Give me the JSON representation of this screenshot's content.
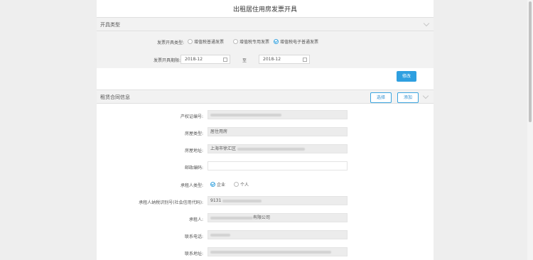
{
  "page_title": "出租居住用房发票开具",
  "invoice_section": {
    "title": "开具类型",
    "type_label": "发票开具类型:",
    "type_options": [
      {
        "label": "增值税普通发票",
        "selected": false
      },
      {
        "label": "增值税专用发票",
        "selected": false
      },
      {
        "label": "增值税电子普通发票",
        "selected": true
      }
    ],
    "period_label": "发票开具期限:",
    "period_start": "2018-12",
    "period_sep": "至",
    "period_end": "2018-12",
    "modify_button": "修改"
  },
  "contract_section": {
    "title": "租赁合同信息",
    "select_button": "选择",
    "add_button": "添加",
    "fields": {
      "property_cert_label": "产权证编号:",
      "property_cert_value": "",
      "house_type_label": "房屋类型:",
      "house_type_value": "居住用房",
      "address_label": "房屋地址:",
      "address_value": "上海市徐汇区",
      "postal_label": "邮政编码:",
      "postal_value": "",
      "lessee_type_label": "承租人类型:",
      "lessee_type_options": [
        {
          "label": "企业",
          "selected": true
        },
        {
          "label": "个人",
          "selected": false
        }
      ],
      "tax_id_label": "承租人纳税识别号(社会信用代码):",
      "tax_id_value": "9131",
      "lessee_label": "承租人:",
      "lessee_value": "有限公司",
      "phone_label": "联系电话:",
      "phone_value": "",
      "contact_addr_label": "联系地址:",
      "contact_addr_value": ""
    }
  },
  "colors": {
    "accent": "#2e9fe0",
    "section_bg": "#f2f2f2",
    "page_bg": "#eeeeee"
  }
}
